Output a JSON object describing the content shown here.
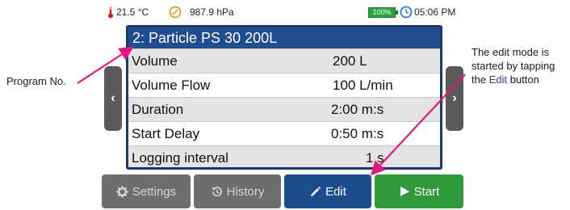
{
  "callouts": {
    "program_no": "Program No.",
    "edit_mode_1": "The edit mode is",
    "edit_mode_2": "started by tapping",
    "edit_mode_3_prefix": "the ",
    "edit_mode_3_word": "Edit",
    "edit_mode_3_suffix": " button"
  },
  "status": {
    "temperature": "21.5 °C",
    "pressure": "987.9 hPa",
    "battery": "100%",
    "time": "05:06 PM"
  },
  "program": {
    "title": "2: Particle PS 30 200L",
    "rows": [
      {
        "label": "Volume",
        "value": "200 L"
      },
      {
        "label": "Volume Flow",
        "value": "100 L/min"
      },
      {
        "label": "Duration",
        "value": "2:00 m:s"
      },
      {
        "label": "Start Delay",
        "value": "0:50 m:s"
      },
      {
        "label": "Logging interval",
        "value": "1 s"
      }
    ]
  },
  "nav": {
    "prev": "‹",
    "next": "›"
  },
  "buttons": {
    "settings": "Settings",
    "history": "History",
    "edit": "Edit",
    "start": "Start"
  },
  "colors": {
    "title_bar": "#1f4d8f",
    "edit_button": "#1d4c8c",
    "start_button": "#2f9a3b",
    "disabled_button": "#6e6e6e",
    "callout_arrow": "#e4177f"
  }
}
